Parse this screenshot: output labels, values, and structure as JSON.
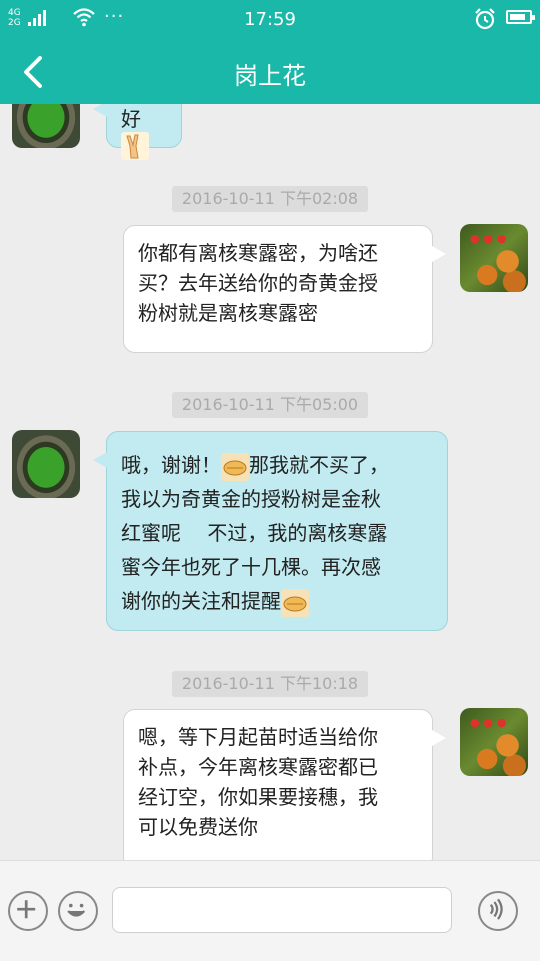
{
  "status_bar": {
    "network_top": "4G",
    "network_bottom": "2G",
    "network_mid": "2G",
    "time": "17:59",
    "more": "···"
  },
  "header": {
    "title": "岗上花"
  },
  "messages": [
    {
      "side": "left",
      "lines": [
        "好"
      ],
      "emoji": "victory-hand"
    },
    {
      "timestamp": "2016-10-11 下午02:08"
    },
    {
      "side": "right",
      "lines": [
        "你都有离核寒露密，为啥还",
        "买？去年送给你的奇黄金授",
        "粉树就是离核寒露密"
      ]
    },
    {
      "timestamp": "2016-10-11 下午05:00"
    },
    {
      "side": "left",
      "lines": [
        "哦，谢谢！",
        "那我就不买了，",
        "我以为奇黄金的授粉树是金秋",
        "红蜜呢　 不过，我的离核寒露",
        "蜜今年也死了十几棵。再次感",
        "谢你的关注和提醒"
      ]
    },
    {
      "timestamp": "2016-10-11 下午10:18"
    },
    {
      "side": "right",
      "lines": [
        "嗯，等下月起苗时适当给你",
        "补点，今年离核寒露密都已",
        "经订空，你如果要接穗，我",
        "可以免费送你"
      ]
    }
  ],
  "input_bar": {
    "plus_icon": "plus-icon",
    "emoji_icon": "smile-icon",
    "voice_icon": "voice-icon",
    "placeholder": ""
  },
  "colors": {
    "accent": "#1ab8a8",
    "left_bubble": "#c1ebf0",
    "right_bubble": "#ffffff",
    "background": "#ededed"
  }
}
